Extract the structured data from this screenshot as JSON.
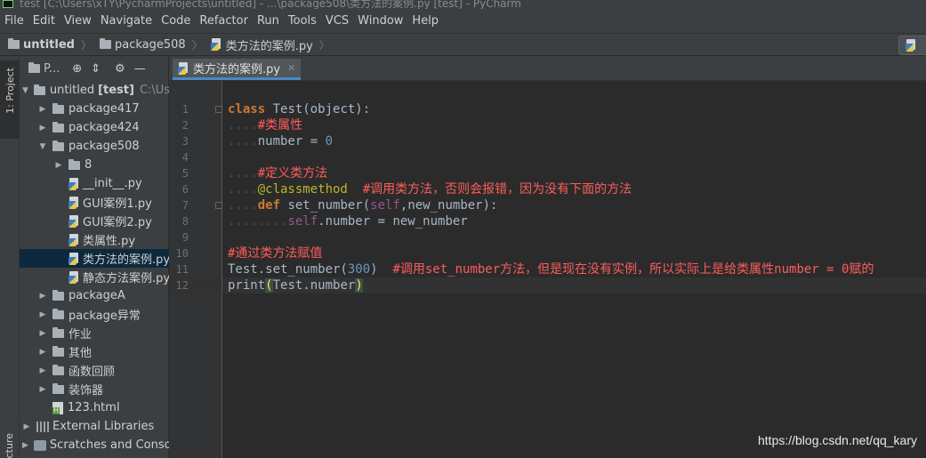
{
  "window": {
    "title": "test [C:\\Users\\xTY\\PycharmProjects\\untitled] - ...\\package508\\类方法的案例.py [test] - PyCharm"
  },
  "menu": [
    "File",
    "Edit",
    "View",
    "Navigate",
    "Code",
    "Refactor",
    "Run",
    "Tools",
    "VCS",
    "Window",
    "Help"
  ],
  "breadcrumb": {
    "project": "untitled",
    "package": "package508",
    "file": "类方法的案例.py"
  },
  "toolstrip": {
    "project_tab": "1: Project",
    "structure_tab": "cture"
  },
  "project_panel": {
    "title": "P...",
    "tree": [
      {
        "label": "untitled",
        "bold_suffix": "[test]",
        "suffix": "C:\\User",
        "kind": "folder",
        "expanded": true,
        "level": 0
      },
      {
        "label": "package417",
        "kind": "folder",
        "expanded": false,
        "level": 1
      },
      {
        "label": "package424",
        "kind": "folder",
        "expanded": false,
        "level": 1
      },
      {
        "label": "package508",
        "kind": "folder",
        "expanded": true,
        "level": 1
      },
      {
        "label": "8",
        "kind": "folder",
        "expanded": false,
        "level": 2
      },
      {
        "label": "__init__.py",
        "kind": "py",
        "level": 2
      },
      {
        "label": "GUI案例1.py",
        "kind": "py",
        "level": 2
      },
      {
        "label": "GUI案例2.py",
        "kind": "py",
        "level": 2
      },
      {
        "label": "类属性.py",
        "kind": "py",
        "level": 2
      },
      {
        "label": "类方法的案例.py",
        "kind": "py",
        "level": 2,
        "selected": true
      },
      {
        "label": "静态方法案例.py",
        "kind": "py",
        "level": 2
      },
      {
        "label": "packageA",
        "kind": "folder",
        "expanded": false,
        "level": 1
      },
      {
        "label": "package异常",
        "kind": "folder",
        "expanded": false,
        "level": 1
      },
      {
        "label": "作业",
        "kind": "folder",
        "expanded": false,
        "level": 1
      },
      {
        "label": "其他",
        "kind": "folder",
        "expanded": false,
        "level": 1
      },
      {
        "label": "函数回顾",
        "kind": "folder",
        "expanded": false,
        "level": 1
      },
      {
        "label": "装饰器",
        "kind": "folder",
        "expanded": false,
        "level": 1
      },
      {
        "label": "123.html",
        "kind": "html",
        "level": 1
      },
      {
        "label": "External Libraries",
        "kind": "lib",
        "expanded": false,
        "level": 0
      },
      {
        "label": "Scratches and Console",
        "kind": "scratch",
        "expanded": false,
        "level": 0
      }
    ]
  },
  "editor": {
    "tab": "类方法的案例.py",
    "current_line": 12,
    "lines": [
      {
        "n": "1",
        "html": "<span class='kw'>class</span> Test(object):"
      },
      {
        "n": "2",
        "html": "<span class='ws'>....</span><span class='cm'>#类属性</span>"
      },
      {
        "n": "3",
        "html": "<span class='ws'>....</span>number = <span class='num'>0</span>"
      },
      {
        "n": "4",
        "html": ""
      },
      {
        "n": "5",
        "html": "<span class='ws'>....</span><span class='cm'>#定义类方法</span>"
      },
      {
        "n": "6",
        "html": "<span class='ws'>....</span><span class='deco'>@classmethod</span>  <span class='cm'>#调用类方法，否则会报错，因为没有下面的方法</span>"
      },
      {
        "n": "7",
        "html": "<span class='ws'>....</span><span class='kw'>def</span> set_number(<span class='self'>self</span>,new_number):"
      },
      {
        "n": "8",
        "html": "<span class='ws'>........</span><span class='self'>self</span>.number = new_number"
      },
      {
        "n": "9",
        "html": ""
      },
      {
        "n": "10",
        "html": "<span class='cm'>#通过类方法赋值</span>"
      },
      {
        "n": "11",
        "html": "Test.set_number(<span class='num'>300</span>)  <span class='cm'>#调用set_number方法，但是现在没有实例，所以实际上是给类属性number = 0赋的</span>"
      },
      {
        "n": "12",
        "html": "print<span class='paren-hl'>(</span>Test.number<span class='paren-hl'>)</span>"
      }
    ]
  },
  "watermark": "https://blog.csdn.net/qq_kary"
}
